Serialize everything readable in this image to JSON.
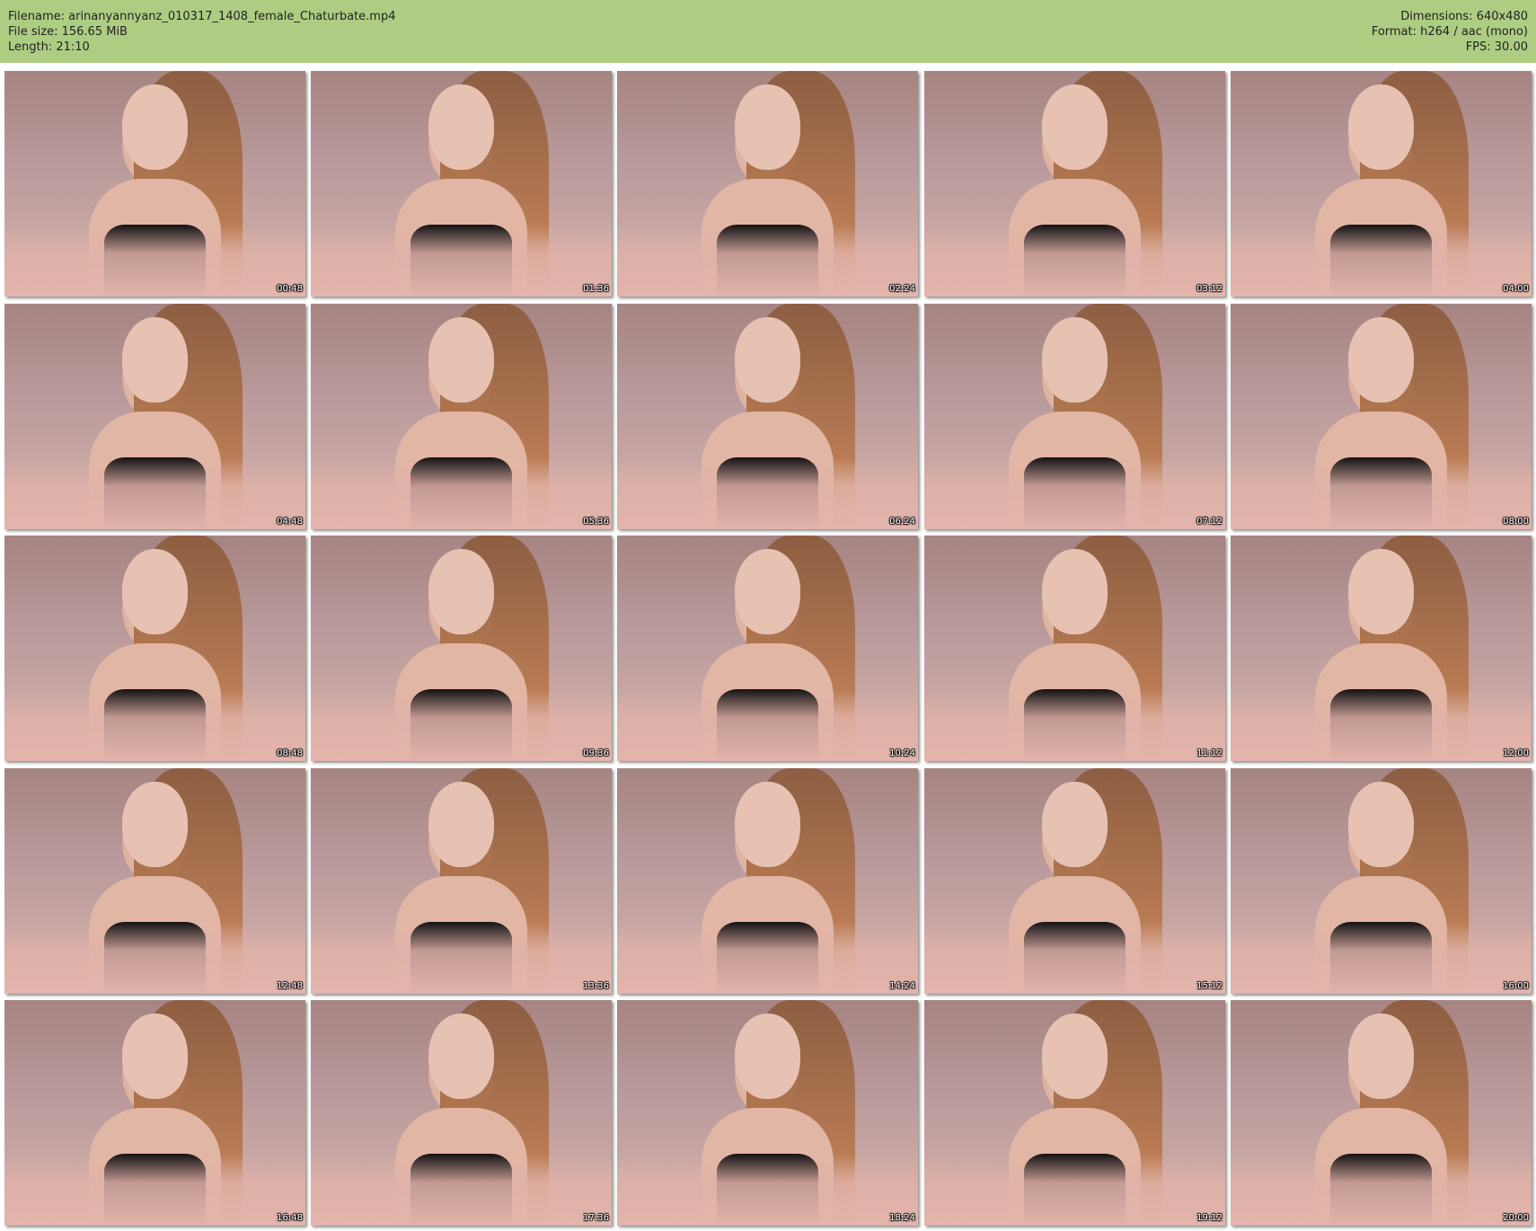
{
  "header": {
    "filename": "Filename: arinanyannyanz_010317_1408_female_Chaturbate.mp4",
    "filesize": "File size: 156.65 MiB",
    "length": "Length: 21:10",
    "dimensions": "Dimensions: 640x480",
    "format": "Format: h264 / aac (mono)",
    "fps": "FPS: 30.00"
  },
  "colors": {
    "header_bg": "#aecd82",
    "page_bg": "#ffffff"
  },
  "thumbnails": [
    {
      "time": "00:48"
    },
    {
      "time": "01:36"
    },
    {
      "time": "02:24"
    },
    {
      "time": "03:12"
    },
    {
      "time": "04:00"
    },
    {
      "time": "04:48"
    },
    {
      "time": "05:36"
    },
    {
      "time": "06:24"
    },
    {
      "time": "07:12"
    },
    {
      "time": "08:00"
    },
    {
      "time": "08:48"
    },
    {
      "time": "09:36"
    },
    {
      "time": "10:24"
    },
    {
      "time": "11:12"
    },
    {
      "time": "12:00"
    },
    {
      "time": "12:48"
    },
    {
      "time": "13:36"
    },
    {
      "time": "14:24"
    },
    {
      "time": "15:12"
    },
    {
      "time": "16:00"
    },
    {
      "time": "16:48"
    },
    {
      "time": "17:36"
    },
    {
      "time": "18:24"
    },
    {
      "time": "19:12"
    },
    {
      "time": "20:00"
    }
  ]
}
